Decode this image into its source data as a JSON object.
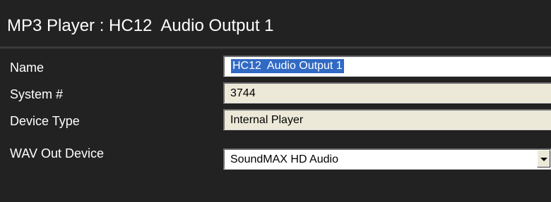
{
  "window": {
    "title": "MP3 Player : HC12  Audio Output 1"
  },
  "fields": {
    "name": {
      "label": "Name",
      "value": "HC12  Audio Output 1"
    },
    "system_number": {
      "label": "System #",
      "value": "3744"
    },
    "device_type": {
      "label": "Device Type",
      "value": "Internal Player"
    },
    "wav_out_device": {
      "label": "WAV Out Device",
      "value": "SoundMAX HD Audio",
      "icon": "chevron-down-icon"
    }
  },
  "colors": {
    "background": "#222222",
    "readonly_field": "#ece9d8",
    "selection": "#316ac5"
  }
}
